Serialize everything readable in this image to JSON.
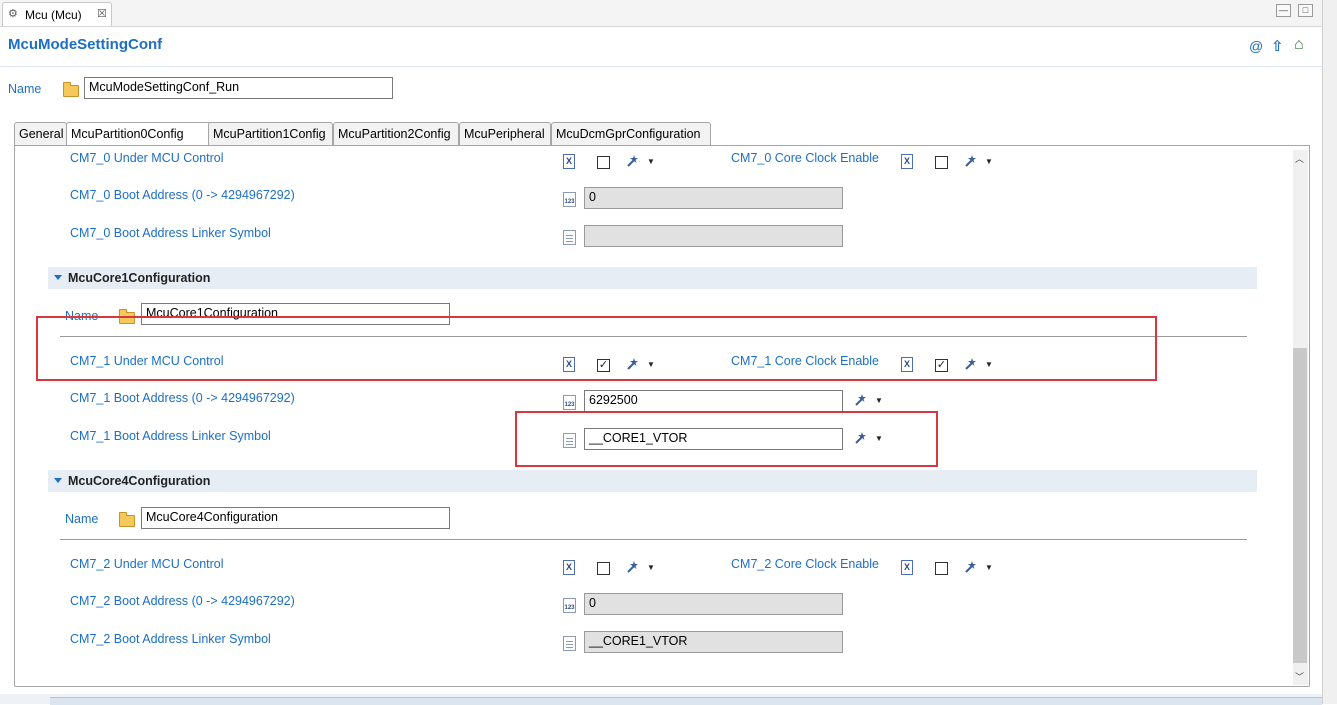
{
  "editor_tab": {
    "title": "Mcu (Mcu)",
    "close": "☒"
  },
  "window_controls": {
    "minimize": "—",
    "maximize": "□"
  },
  "page_title": "McuModeSettingConf",
  "header_icons": {
    "at": "@",
    "up": "⇧",
    "home": "⌂"
  },
  "name_row": {
    "label": "Name",
    "value": "McuModeSettingConf_Run"
  },
  "tabs": [
    {
      "label": "General"
    },
    {
      "label": "McuPartition0Config"
    },
    {
      "label": "McuPartition1Config"
    },
    {
      "label": "McuPartition2Config"
    },
    {
      "label": "McuPeripheral"
    },
    {
      "label": "McuDcmGprConfiguration"
    }
  ],
  "core0": {
    "under_control_label": "CM7_0 Under MCU Control",
    "clock_enable_label": "CM7_0 Core Clock Enable",
    "boot_address_label": "CM7_0 Boot Address (0 -> 4294967292)",
    "boot_address_value": "0",
    "linker_symbol_label": "CM7_0 Boot Address Linker Symbol",
    "linker_symbol_value": ""
  },
  "core1": {
    "section_title": "McuCore1Configuration",
    "name_label": "Name",
    "name_value": "McuCore1Configuration",
    "under_control_label": "CM7_1 Under MCU Control",
    "clock_enable_label": "CM7_1 Core Clock Enable",
    "under_control_checked": "✓",
    "clock_enable_checked": "✓",
    "boot_address_label": "CM7_1 Boot Address (0 -> 4294967292)",
    "boot_address_value": "6292500",
    "linker_symbol_label": "CM7_1 Boot Address Linker Symbol",
    "linker_symbol_value": "__CORE1_VTOR"
  },
  "core4": {
    "section_title": "McuCore4Configuration",
    "name_label": "Name",
    "name_value": "McuCore4Configuration",
    "under_control_label": "CM7_2 Under MCU Control",
    "clock_enable_label": "CM7_2 Core Clock Enable",
    "boot_address_label": "CM7_2 Boot Address (0 -> 4294967292)",
    "boot_address_value": "0",
    "linker_symbol_label": "CM7_2 Boot Address Linker Symbol",
    "linker_symbol_value": "__CORE1_VTOR"
  },
  "colors": {
    "link": "#1c6fc4",
    "highlight": "#d9373f",
    "section_bg": "#e6edf5"
  }
}
